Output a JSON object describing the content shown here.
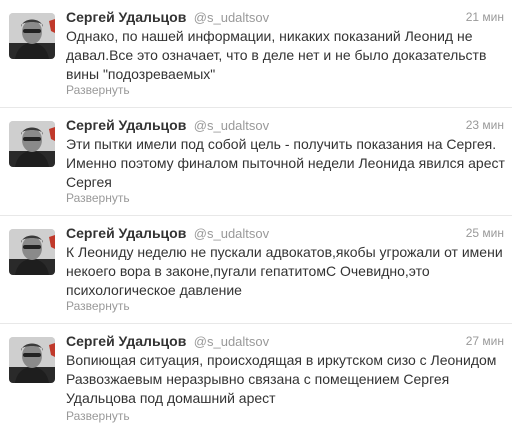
{
  "tweets": [
    {
      "name": "Сергей Удальцов",
      "handle": "@s_udaltsov",
      "time": "21 мин",
      "text": "Однако, по нашей информации, никаких показаний Леонид не давал.Все это означает, что в деле нет и не было доказательств вины \"подозреваемых\"",
      "expand": "Развернуть"
    },
    {
      "name": "Сергей Удальцов",
      "handle": "@s_udaltsov",
      "time": "23 мин",
      "text": "Эти пытки имели под собой цель - получить показания на Сергея. Именно поэтому финалом пыточной недели Леонида явился арест Сергея",
      "expand": "Развернуть"
    },
    {
      "name": "Сергей Удальцов",
      "handle": "@s_udaltsov",
      "time": "25 мин",
      "text": "К Леониду неделю не пускали адвокатов,якобы угрожали от имени некоего вора в законе,пугали гепатитомС Очевидно,это психологическое давление",
      "expand": "Развернуть"
    },
    {
      "name": "Сергей Удальцов",
      "handle": "@s_udaltsov",
      "time": "27 мин",
      "text": "Вопиющая ситуация, происходящая в иркутском сизо с Леонидом Развозжаевым неразрывно связана с помещением Сергея Удальцова под домашний арест",
      "expand": "Развернуть"
    }
  ]
}
